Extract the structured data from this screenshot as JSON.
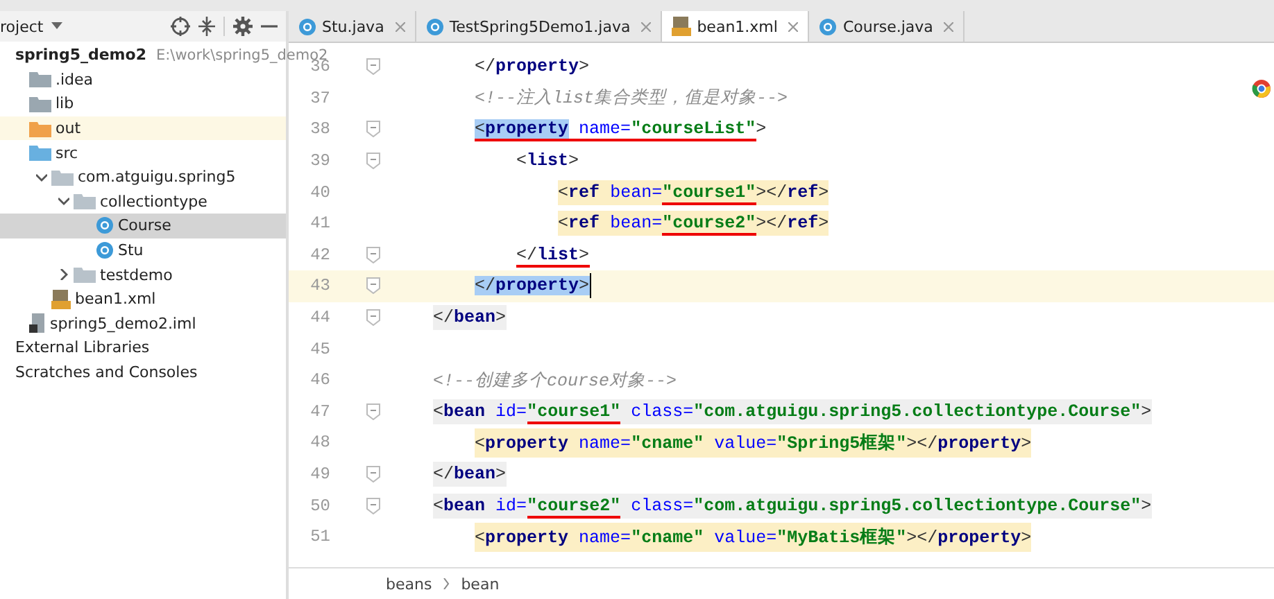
{
  "project_panel": {
    "title": "roject",
    "tree": [
      {
        "label": "spring5_demo2",
        "path": "E:\\work\\spring5_demo2",
        "bold": true,
        "selected": false,
        "children": [
          {
            "label": ".idea",
            "kind": "folder",
            "selected": false
          },
          {
            "label": "lib",
            "kind": "folder",
            "selected": false
          },
          {
            "label": "out",
            "kind": "excluded-folder",
            "selected": false,
            "tinted": true
          },
          {
            "label": "src",
            "kind": "source-folder",
            "selected": false,
            "children": [
              {
                "label": "com.atguigu.spring5",
                "kind": "package",
                "expanded": true,
                "selected": false,
                "children": [
                  {
                    "label": "collectiontype",
                    "kind": "package",
                    "expanded": true,
                    "selected": false,
                    "children": [
                      {
                        "label": "Course",
                        "kind": "class",
                        "selected": true
                      },
                      {
                        "label": "Stu",
                        "kind": "class",
                        "selected": false
                      }
                    ]
                  },
                  {
                    "label": "testdemo",
                    "kind": "package",
                    "expanded": false,
                    "selected": false
                  }
                ]
              },
              {
                "label": "bean1.xml",
                "kind": "xml",
                "selected": false
              }
            ]
          },
          {
            "label": "spring5_demo2.iml",
            "kind": "iml",
            "selected": false
          }
        ]
      },
      {
        "label": "External Libraries",
        "selected": false
      },
      {
        "label": "Scratches and Consoles",
        "selected": false
      }
    ]
  },
  "tabs": [
    {
      "label": "Stu.java",
      "kind": "class",
      "selected": false
    },
    {
      "label": "TestSpring5Demo1.java",
      "kind": "class",
      "selected": false
    },
    {
      "label": "bean1.xml",
      "kind": "xml",
      "selected": true
    },
    {
      "label": "Course.java",
      "kind": "class",
      "selected": false
    }
  ],
  "editor": {
    "lines": [
      {
        "number": "36",
        "fold": true,
        "current": false,
        "kind": "plain",
        "tokens": [
          {
            "kind": "p",
            "text": "        </"
          },
          {
            "kind": "tag",
            "text": "property"
          },
          {
            "kind": "p",
            "text": ">"
          }
        ]
      },
      {
        "number": "37",
        "fold": false,
        "current": false,
        "kind": "plain",
        "tokens": [
          {
            "kind": "cmt",
            "text": "        <!--注入list集合类型，值是对象-->"
          }
        ]
      },
      {
        "number": "38",
        "fold": true,
        "current": false,
        "kind": "plain",
        "tokens": [
          {
            "kind": "p",
            "text": "        <",
            "match": true,
            "underline": true
          },
          {
            "kind": "tag",
            "text": "property",
            "match": true,
            "underline": true
          },
          {
            "kind": "attr",
            "text": " name=",
            "underline": true
          },
          {
            "kind": "val",
            "text": "\"courseList\"",
            "underline": true
          },
          {
            "kind": "p",
            "text": ">"
          }
        ]
      },
      {
        "number": "39",
        "fold": true,
        "current": false,
        "kind": "plain",
        "tokens": [
          {
            "kind": "p",
            "text": "            <"
          },
          {
            "kind": "tag",
            "text": "list"
          },
          {
            "kind": "p",
            "text": ">"
          }
        ]
      },
      {
        "number": "40",
        "fold": false,
        "current": false,
        "kind": "tag-pair",
        "tokens": [
          {
            "kind": "p",
            "text": "                <"
          },
          {
            "kind": "tag",
            "text": "ref"
          },
          {
            "kind": "attr",
            "text": " bean="
          },
          {
            "kind": "val",
            "text": "\"course1\"",
            "underline": true
          },
          {
            "kind": "p",
            "text": "></"
          },
          {
            "kind": "tag",
            "text": "ref"
          },
          {
            "kind": "p",
            "text": ">"
          }
        ]
      },
      {
        "number": "41",
        "fold": false,
        "current": false,
        "kind": "tag-pair",
        "tokens": [
          {
            "kind": "p",
            "text": "                <"
          },
          {
            "kind": "tag",
            "text": "ref"
          },
          {
            "kind": "attr",
            "text": " bean="
          },
          {
            "kind": "val",
            "text": "\"course2\"",
            "underline": true
          },
          {
            "kind": "p",
            "text": "></"
          },
          {
            "kind": "tag",
            "text": "ref"
          },
          {
            "kind": "p",
            "text": ">"
          }
        ]
      },
      {
        "number": "42",
        "fold": true,
        "current": false,
        "kind": "plain",
        "tokens": [
          {
            "kind": "p",
            "text": "            </",
            "underline": true
          },
          {
            "kind": "tag",
            "text": "list",
            "underline": true
          },
          {
            "kind": "p",
            "text": ">",
            "underline": true
          }
        ]
      },
      {
        "number": "43",
        "fold": true,
        "current": true,
        "kind": "plain",
        "tokens": [
          {
            "kind": "p",
            "text": "        </",
            "match": true
          },
          {
            "kind": "tag",
            "text": "property",
            "match": true
          },
          {
            "kind": "p",
            "text": ">",
            "match": true
          }
        ]
      },
      {
        "number": "44",
        "fold": true,
        "current": false,
        "kind": "bean",
        "tokens": [
          {
            "kind": "p",
            "text": "    </"
          },
          {
            "kind": "tag",
            "text": "bean"
          },
          {
            "kind": "p",
            "text": ">"
          }
        ]
      },
      {
        "number": "45",
        "fold": false,
        "current": false
      },
      {
        "number": "46",
        "fold": false,
        "current": false,
        "kind": "plain",
        "tokens": [
          {
            "kind": "cmt",
            "text": "    <!--创建多个course对象-->"
          }
        ]
      },
      {
        "number": "47",
        "fold": true,
        "current": false,
        "kind": "bean",
        "tokens": [
          {
            "kind": "p",
            "text": "    <"
          },
          {
            "kind": "tag",
            "text": "bean"
          },
          {
            "kind": "attr",
            "text": " id="
          },
          {
            "kind": "val",
            "text": "\"course1\"",
            "underline": true
          },
          {
            "kind": "attr",
            "text": " class="
          },
          {
            "kind": "val",
            "text": "\"com.atguigu.spring5.collectiontype.Course\""
          },
          {
            "kind": "p",
            "text": ">"
          }
        ]
      },
      {
        "number": "48",
        "fold": false,
        "current": false,
        "kind": "tag-pair",
        "tokens": [
          {
            "kind": "p",
            "text": "        <"
          },
          {
            "kind": "tag",
            "text": "property"
          },
          {
            "kind": "attr",
            "text": " name="
          },
          {
            "kind": "val",
            "text": "\"cname\""
          },
          {
            "kind": "attr",
            "text": " value="
          },
          {
            "kind": "val",
            "text": "\"Spring5框架\""
          },
          {
            "kind": "p",
            "text": "></"
          },
          {
            "kind": "tag",
            "text": "property"
          },
          {
            "kind": "p",
            "text": ">"
          }
        ]
      },
      {
        "number": "49",
        "fold": true,
        "current": false,
        "kind": "bean",
        "tokens": [
          {
            "kind": "p",
            "text": "    </"
          },
          {
            "kind": "tag",
            "text": "bean"
          },
          {
            "kind": "p",
            "text": ">"
          }
        ]
      },
      {
        "number": "50",
        "fold": true,
        "current": false,
        "kind": "bean",
        "tokens": [
          {
            "kind": "p",
            "text": "    <"
          },
          {
            "kind": "tag",
            "text": "bean"
          },
          {
            "kind": "attr",
            "text": " id="
          },
          {
            "kind": "val",
            "text": "\"course2\"",
            "underline": true
          },
          {
            "kind": "attr",
            "text": " class="
          },
          {
            "kind": "val",
            "text": "\"com.atguigu.spring5.collectiontype.Course\""
          },
          {
            "kind": "p",
            "text": ">"
          }
        ]
      },
      {
        "number": "51",
        "fold": false,
        "current": false,
        "kind": "tag-pair",
        "tokens": [
          {
            "kind": "p",
            "text": "        <"
          },
          {
            "kind": "tag",
            "text": "property"
          },
          {
            "kind": "attr",
            "text": " name="
          },
          {
            "kind": "val",
            "text": "\"cname\""
          },
          {
            "kind": "attr",
            "text": " value="
          },
          {
            "kind": "val",
            "text": "\"MyBatis框架\""
          },
          {
            "kind": "p",
            "text": "></"
          },
          {
            "kind": "tag",
            "text": "property"
          },
          {
            "kind": "p",
            "text": ">"
          }
        ]
      }
    ]
  },
  "breadcrumb": [
    "beans",
    "bean"
  ]
}
